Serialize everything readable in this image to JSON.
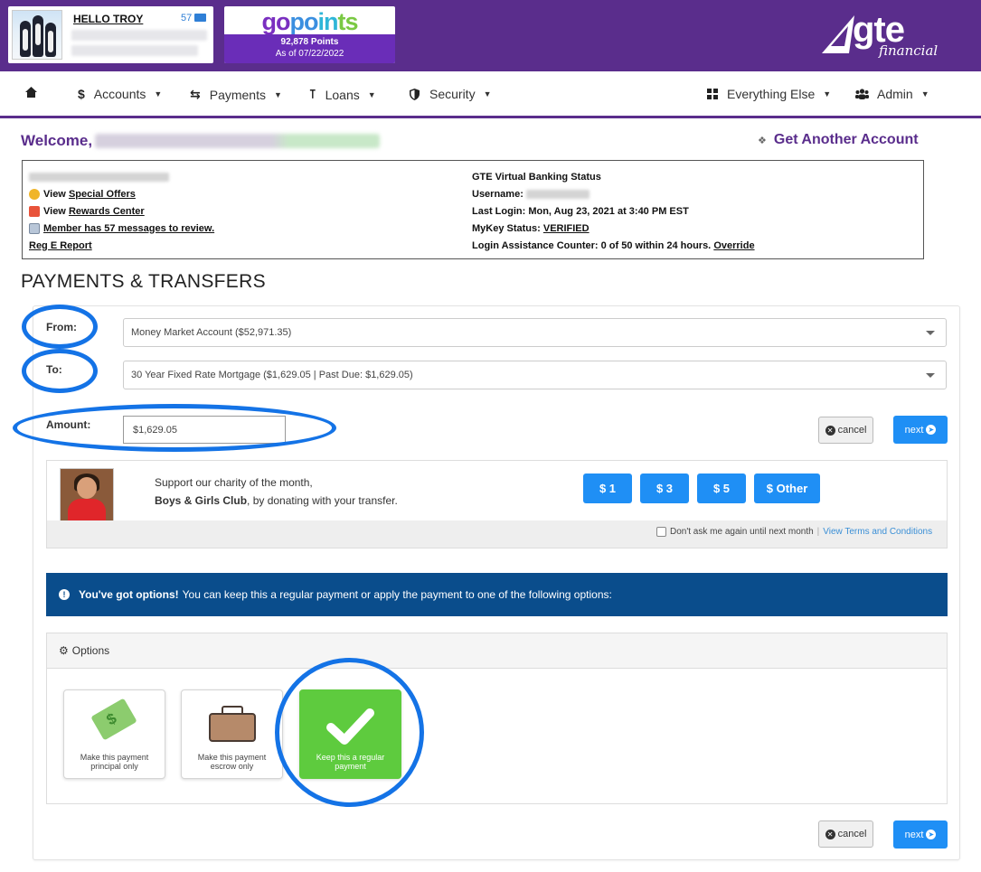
{
  "header": {
    "hello": "HELLO TROY",
    "message_count": "57",
    "points": "92,878 Points",
    "points_asof": "As of 07/22/2022",
    "gopoints_logo": [
      "go",
      "po",
      "in",
      "ts"
    ],
    "brand": "gte",
    "brand_sub": "financial"
  },
  "nav": {
    "home_icon": "home-icon",
    "items": [
      {
        "icon": "dollar-icon",
        "label": "Accounts"
      },
      {
        "icon": "transfer-icon",
        "label": "Payments"
      },
      {
        "icon": "key-icon",
        "label": "Loans"
      },
      {
        "icon": "shield-icon",
        "label": "Security"
      },
      {
        "icon": "grid-icon",
        "label": "Everything Else"
      },
      {
        "icon": "users-icon",
        "label": "Admin"
      }
    ]
  },
  "welcome": {
    "label": "Welcome,",
    "get_account": "Get Another Account"
  },
  "info": {
    "view": "View",
    "special_offers": "Special Offers",
    "rewards_center": "Rewards Center",
    "messages": "Member has 57 messages to review.",
    "reg_e": "Reg E Report",
    "status_title": "GTE Virtual Banking Status",
    "username_label": "Username:",
    "last_login": "Last Login: Mon, Aug 23, 2021 at 3:40 PM EST",
    "mykey_label": "MyKey Status:",
    "mykey_value": "VERIFIED",
    "login_assist": "Login Assistance Counter: 0 of 50 within 24 hours.",
    "override": "Override"
  },
  "payments": {
    "title": "PAYMENTS & TRANSFERS",
    "from_label": "From:",
    "from_value": "Money Market Account ($52,971.35)",
    "to_label": "To:",
    "to_value": "30 Year Fixed Rate Mortgage ($1,629.05 | Past Due: $1,629.05)",
    "amount_label": "Amount:",
    "amount_value": "$1,629.05",
    "cancel": "cancel",
    "next": "next"
  },
  "charity": {
    "line1": "Support our charity of the month,",
    "org": "Boys & Girls Club",
    "line2_rest": ", by donating with your transfer.",
    "buttons": [
      "$ 1",
      "$ 3",
      "$ 5",
      "$ Other"
    ],
    "dont_ask": "Don't ask me again until next month",
    "terms": "View Terms and Conditions"
  },
  "alert": {
    "bold": "You've got options!",
    "text": "You can keep this a regular payment or apply the payment to one of the following options:"
  },
  "options": {
    "header": "Options",
    "cards": [
      {
        "icon": "money-tag-icon",
        "line1": "Make this payment",
        "line2": "principal only",
        "selected": false
      },
      {
        "icon": "briefcase-icon",
        "line1": "Make this payment",
        "line2": "escrow only",
        "selected": false
      },
      {
        "icon": "checkmark-icon",
        "line1": "Keep this a regular",
        "line2": "payment",
        "selected": true
      }
    ]
  },
  "colors": {
    "brand_purple": "#5a2d8c",
    "primary_blue": "#1f8ff5",
    "alert_blue": "#0a4d8c",
    "selected_green": "#5ecb3e",
    "annotation_ring": "#1473e6"
  }
}
